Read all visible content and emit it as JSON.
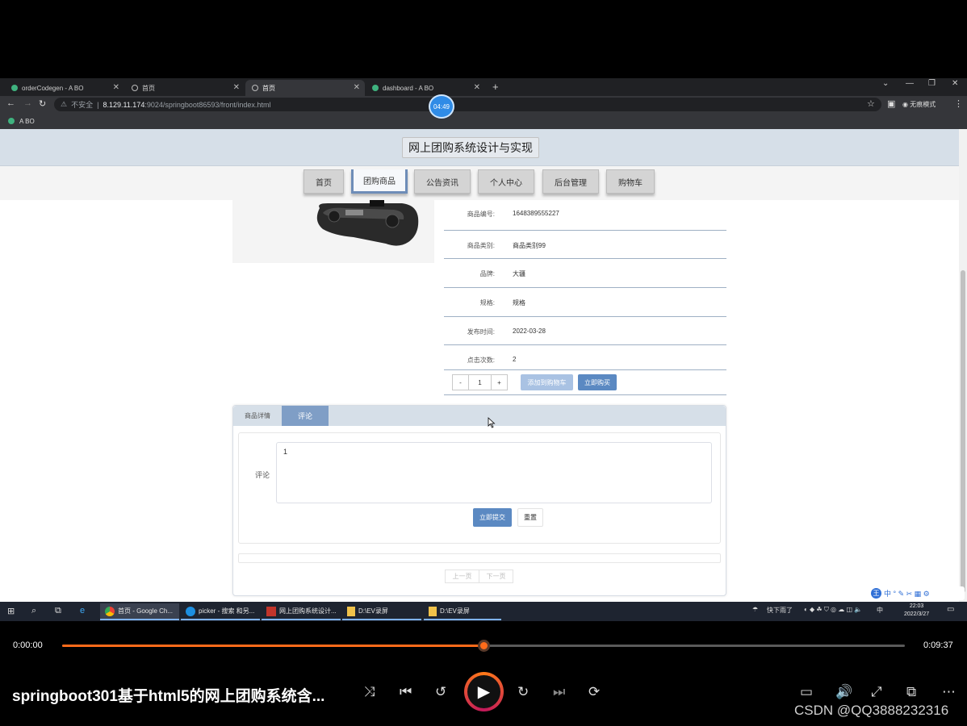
{
  "browser": {
    "tabs": [
      {
        "title": "orderCodegen - A BO",
        "active": false
      },
      {
        "title": "首页",
        "active": false
      },
      {
        "title": "首页",
        "active": true
      },
      {
        "title": "dashboard - A BO",
        "active": false
      }
    ],
    "security_label": "不安全",
    "url_host": "8.129.11.174",
    "url_rest": ":9024/springboot86593/front/index.html",
    "profile_label": "无痕模式",
    "bookmark": "A BO",
    "recording_time": "04:49"
  },
  "site": {
    "title": "网上团购系统设计与实现",
    "nav": [
      {
        "label": "首页",
        "active": false
      },
      {
        "label": "团购商品",
        "active": true
      },
      {
        "label": "公告资讯",
        "active": false
      },
      {
        "label": "个人中心",
        "active": false
      },
      {
        "label": "后台管理",
        "active": false
      },
      {
        "label": "购物车",
        "active": false
      }
    ]
  },
  "product": {
    "fields": [
      {
        "label": "商品编号:",
        "value": "1648389555227"
      },
      {
        "label": "商品类别:",
        "value": "商品类别99"
      },
      {
        "label": "品牌:",
        "value": "大疆"
      },
      {
        "label": "规格:",
        "value": "规格"
      },
      {
        "label": "发布时间:",
        "value": "2022-03-28"
      },
      {
        "label": "点击次数:",
        "value": "2"
      }
    ],
    "qty_minus": "-",
    "qty_value": "1",
    "qty_plus": "+",
    "add_cart": "添加到购物车",
    "buy_now": "立即购买"
  },
  "detail_tabs": {
    "detail": "商品详情",
    "comment": "评论",
    "comment_label": "评论",
    "comment_value": "1",
    "submit": "立即提交",
    "reset": "重置",
    "prev": "上一页",
    "next": "下一页"
  },
  "taskbar": {
    "items": [
      "首页 - Google Ch...",
      "picker - 搜索 和另...",
      "网上团购系统设计...",
      "D:\\EV录屏",
      "D:\\EV录屏"
    ],
    "weather": "快下雨了",
    "ime": "中",
    "time": "22:03",
    "date": "2022/3/27"
  },
  "player": {
    "current_time": "0:00:00",
    "total_time": "0:09:37",
    "progress_fraction": 0.5,
    "title": "springboot301基于html5的网上团购系统含...",
    "watermark": "CSDN @QQ3888232316",
    "accent": "#ff6b1a"
  }
}
